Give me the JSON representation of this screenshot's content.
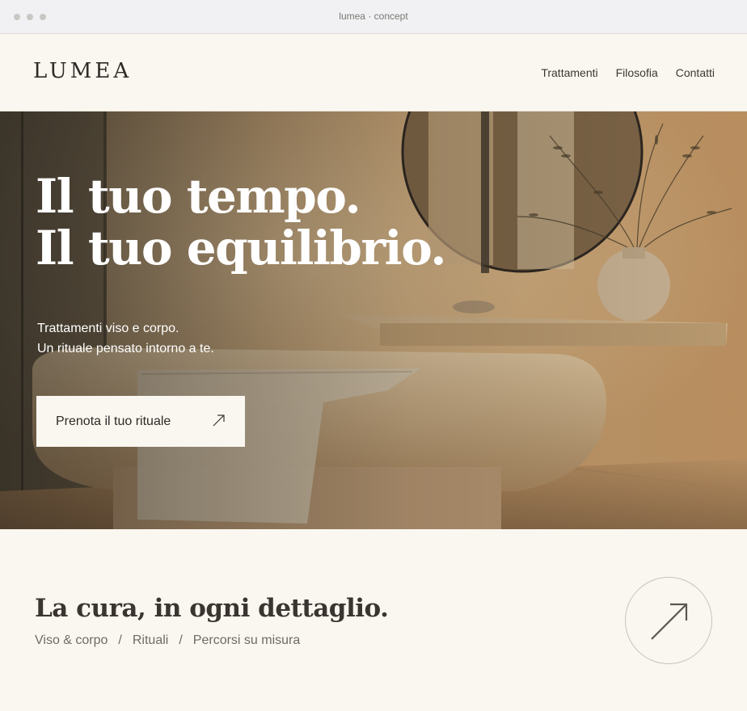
{
  "browser": {
    "title": "lumea · concept"
  },
  "header": {
    "logo": "LUMEA",
    "nav": [
      "Trattamenti",
      "Filosofia",
      "Contatti"
    ]
  },
  "hero": {
    "title_lines": [
      "Il tuo tempo.",
      "Il tuo equilibrio."
    ],
    "subtitle_lines": [
      "Trattamenti viso e corpo.",
      "Un rituale pensato intorno a te."
    ],
    "cta_label": "Prenota il tuo rituale",
    "cta_icon": "arrow-up-right-icon"
  },
  "care": {
    "title": "La cura, in ogni dettaglio.",
    "links": [
      "Viso & corpo",
      "Rituali",
      "Percorsi su misura"
    ],
    "separator": "/",
    "circle_icon": "arrow-up-right-icon"
  },
  "colors": {
    "background": "#faf7f0",
    "text_dark": "#2e2a26",
    "text_muted": "#6f6a64",
    "hero_warm": "#b08a5e"
  }
}
